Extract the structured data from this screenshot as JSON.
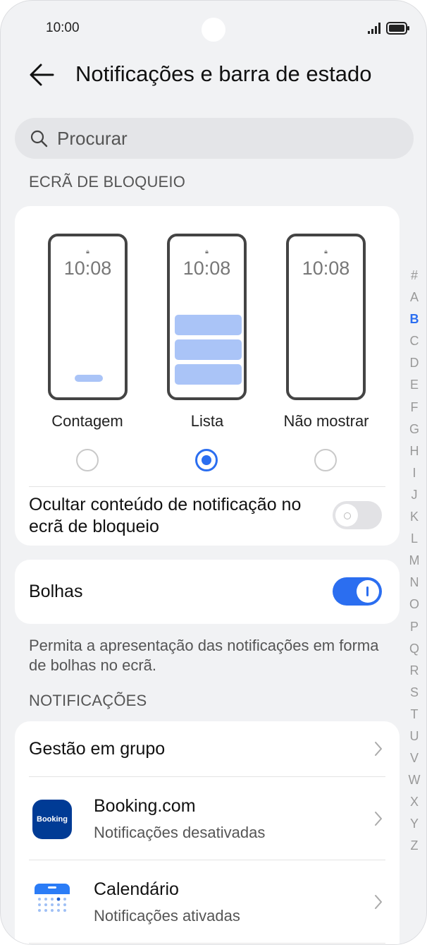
{
  "status_bar": {
    "time": "10:00"
  },
  "header": {
    "title": "Notificações e barra de estado"
  },
  "search": {
    "placeholder": "Procurar"
  },
  "lock_screen": {
    "section_label": "ECRÃ DE BLOQUEIO",
    "mock_time": "10:08",
    "options": [
      {
        "label": "Contagem",
        "selected": false
      },
      {
        "label": "Lista",
        "selected": true
      },
      {
        "label": "Não mostrar",
        "selected": false
      }
    ],
    "hide_content": {
      "label": "Ocultar conteúdo de notificação no ecrã de bloqueio",
      "enabled": false
    }
  },
  "bubbles": {
    "label": "Bolhas",
    "enabled": true,
    "description": "Permita a apresentação das notificações em forma de bolhas no ecrã."
  },
  "notifications": {
    "section_label": "NOTIFICAÇÕES",
    "group_management": "Gestão em grupo",
    "apps": [
      {
        "name": "Booking.com",
        "status": "Notificações desativadas",
        "icon": "booking-app-icon",
        "icon_text": "Booking"
      },
      {
        "name": "Calendário",
        "status": "Notificações ativadas",
        "icon": "calendar-app-icon"
      }
    ]
  },
  "alphabet_index": {
    "letters": [
      "#",
      "A",
      "B",
      "C",
      "D",
      "E",
      "F",
      "G",
      "H",
      "I",
      "J",
      "K",
      "L",
      "M",
      "N",
      "O",
      "P",
      "Q",
      "R",
      "S",
      "T",
      "U",
      "V",
      "W",
      "X",
      "Y",
      "Z"
    ],
    "active": "B"
  },
  "colors": {
    "accent": "#2b6ef0",
    "background": "#f1f2f4",
    "booking_brand": "#003b95"
  }
}
